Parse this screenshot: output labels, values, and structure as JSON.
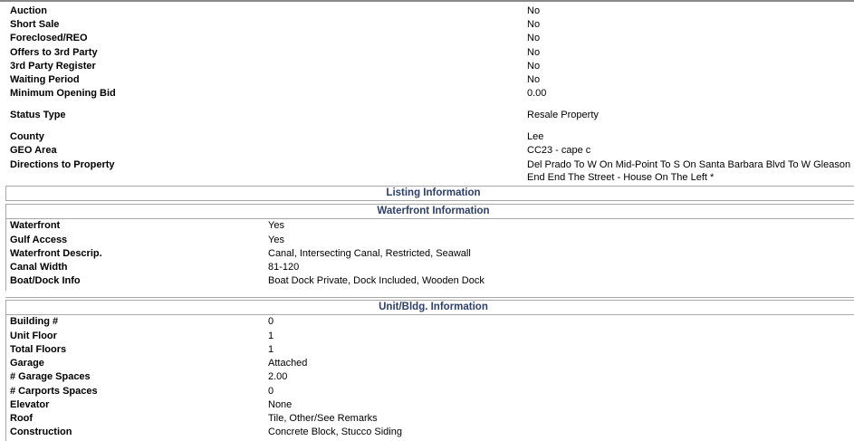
{
  "top": [
    {
      "label": "Auction",
      "value": "No"
    },
    {
      "label": "Short Sale",
      "value": "No"
    },
    {
      "label": "Foreclosed/REO",
      "value": "No"
    },
    {
      "label": "Offers to 3rd Party",
      "value": "No"
    },
    {
      "label": "3rd Party Register",
      "value": "No"
    },
    {
      "label": "Waiting Period",
      "value": "No"
    },
    {
      "label": "Minimum Opening Bid",
      "value": "0.00"
    }
  ],
  "status": {
    "label": "Status Type",
    "value": "Resale Property"
  },
  "location": [
    {
      "label": "County",
      "value": "Lee"
    },
    {
      "label": "GEO Area",
      "value": "CC23 - cape c"
    }
  ],
  "directions": {
    "label": "Directions to Property",
    "line1": "Del Prado To W On Mid-Point To S On Santa Barbara Blvd To W Gleason Pkwy",
    "line2": "End End The Street - House On The Left *"
  },
  "sections": {
    "listing": "Listing Information",
    "waterfront": "Waterfront Information",
    "unit": "Unit/Bldg. Information"
  },
  "waterfront": [
    {
      "label": "Waterfront",
      "value": "Yes"
    },
    {
      "label": "Gulf Access",
      "value": "Yes"
    },
    {
      "label": "Waterfront Descrip.",
      "value": "Canal, Intersecting Canal, Restricted, Seawall"
    },
    {
      "label": "Canal Width",
      "value": "81-120"
    },
    {
      "label": "Boat/Dock Info",
      "value": "Boat Dock Private, Dock Included, Wooden Dock"
    }
  ],
  "unit": [
    {
      "label": "Building #",
      "value": "0"
    },
    {
      "label": "Unit Floor",
      "value": "1"
    },
    {
      "label": "Total Floors",
      "value": "1"
    },
    {
      "label": "Garage",
      "value": "Attached"
    },
    {
      "label": "# Garage Spaces",
      "value": "2.00"
    },
    {
      "label": "# Carports Spaces",
      "value": "0"
    },
    {
      "label": "Elevator",
      "value": "None"
    },
    {
      "label": "Roof",
      "value": "Tile, Other/See Remarks"
    },
    {
      "label": "Construction",
      "value": "Concrete Block, Stucco Siding"
    }
  ]
}
